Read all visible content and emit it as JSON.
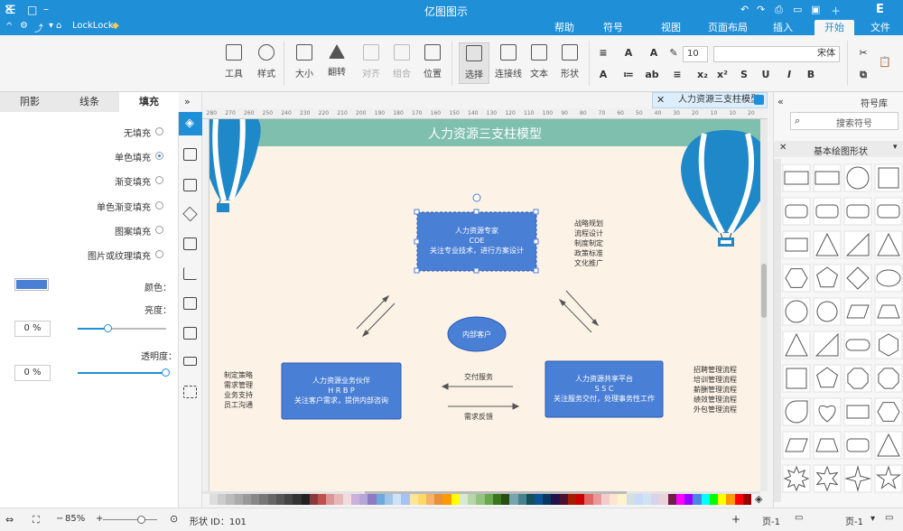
{
  "app": {
    "title": "亿图图示",
    "account": "LockLock"
  },
  "menu": {
    "tabs": [
      {
        "label": "文件"
      },
      {
        "label": "开始",
        "active": true
      },
      {
        "label": "插入"
      },
      {
        "label": "页面布局"
      },
      {
        "label": "视图"
      },
      {
        "label": "符号"
      },
      {
        "label": "帮助"
      }
    ]
  },
  "ribbon": {
    "tools": [
      {
        "label": "工具",
        "icon": "tool-icon"
      },
      {
        "label": "样式",
        "icon": "style-icon"
      },
      {
        "label": "大小",
        "icon": "size-icon"
      },
      {
        "label": "翻转",
        "icon": "flip-icon"
      },
      {
        "label": "对齐",
        "icon": "align-icon"
      },
      {
        "label": "组合",
        "icon": "group-icon"
      },
      {
        "label": "位置",
        "icon": "position-icon"
      },
      {
        "label": "选择",
        "icon": "select-icon"
      },
      {
        "label": "连接线",
        "icon": "connector-icon"
      },
      {
        "label": "文本",
        "icon": "text-icon"
      },
      {
        "label": "形状",
        "icon": "shape-icon"
      }
    ],
    "font_name": "宋体",
    "font_size": "10"
  },
  "left_panel": {
    "tabs": [
      {
        "label": "填充",
        "active": true
      },
      {
        "label": "线条"
      },
      {
        "label": "阴影"
      }
    ],
    "fill_options": [
      {
        "label": "无填充",
        "selected": false
      },
      {
        "label": "单色填充",
        "selected": true
      },
      {
        "label": "渐变填充",
        "selected": false
      },
      {
        "label": "单色渐变填充",
        "selected": false
      },
      {
        "label": "图案填充",
        "selected": false
      },
      {
        "label": "图片或纹理填充",
        "selected": false
      }
    ],
    "color_label": "颜色：",
    "color_value": "#4a7fd6",
    "shade_label": "亮度：",
    "shade_value": "0 %",
    "shade_level": 0.35,
    "transparency_label": "透明度：",
    "transparency_value": "0 %",
    "transparency_level": 1.0
  },
  "document": {
    "tab_title": "人力资源三支柱模型"
  },
  "diagram": {
    "title": "人力资源三支柱模型",
    "coe_box": {
      "line1": "人力资源专家",
      "line2": "COE",
      "line3": "关注专业技术，进行方案设计"
    },
    "hrbp_box": {
      "line1": "人力资源业务伙伴",
      "line2": "H R B P",
      "line3": "关注客户需求，提供内部咨询"
    },
    "ssc_box": {
      "line1": "人力资源共享平台",
      "line2": "S S C",
      "line3": "关注服务交付，处理事务性工作"
    },
    "center_ellipse": "内部客户",
    "arrow_top_label": "交付服务",
    "arrow_bottom_label": "需求反馈",
    "right_top_list": [
      "战略规划",
      "流程设计",
      "制度制定",
      "政策标准",
      "文化推广"
    ],
    "left_list": [
      "制定策略",
      "需求管理",
      "业务支持",
      "员工沟通"
    ],
    "right_list": [
      "招聘管理流程",
      "培训管理流程",
      "薪酬管理流程",
      "绩效管理流程",
      "外包管理流程"
    ],
    "colors": {
      "header_bar": "#7fbfad",
      "box_fill": "#4a7fd6",
      "balloon_blue": "#1f88c8",
      "background": "#fdf2e6"
    }
  },
  "ruler": {
    "ticks": [
      "20",
      "10",
      "10",
      "20",
      "30",
      "40",
      "50",
      "60",
      "70",
      "80",
      "90",
      "100",
      "110",
      "120",
      "130",
      "140",
      "150",
      "160",
      "170",
      "180",
      "190",
      "200",
      "210",
      "220",
      "230",
      "240",
      "250",
      "260",
      "270",
      "280"
    ]
  },
  "right_panel": {
    "title": "符号库",
    "search_placeholder": "搜索符号",
    "library_title": "基本绘图形状"
  },
  "status": {
    "page_selector": "页-1",
    "page_tab": "页-1",
    "shape_id": "形状 ID：101",
    "zoom": "85%"
  }
}
